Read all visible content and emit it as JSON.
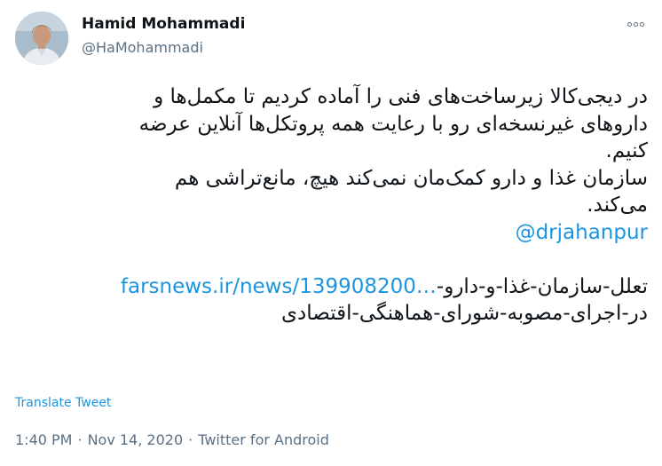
{
  "author": {
    "name": "Hamid Mohammadi",
    "handle": "@HaMohammadi"
  },
  "tweet": {
    "lines": [
      "در دیجی‌کالا زیرساخت‌های فنی را آماده کردیم تا مکمل‌ها و",
      "داروهای غیرنسخه‌ای رو با رعایت همه پروتکل‌ها آنلاین عرضه",
      "کنیم.",
      "سازمان غذا و دارو کمک‌مان نمی‌کند هیچ، مانع‌تراشی هم",
      "می‌کند."
    ],
    "mention": "@drjahanpur",
    "link_text": "farsnews.ir/news/139908200…",
    "link_tail_1": "تعلل-سازمان-غذا-و-دارو-",
    "link_tail_2": "در-اجرای-مصوبه-شورای-هماهنگی-اقتصادی"
  },
  "translate_label": "Translate Tweet",
  "meta": {
    "time": "1:40 PM",
    "date": "Nov 14, 2020",
    "source": "Twitter for Android",
    "separator": "·"
  },
  "icons": {
    "more": "more-options-icon",
    "avatar": "avatar-photo"
  },
  "colors": {
    "link": "#1b95e0",
    "secondary_text": "#5b7083",
    "primary_text": "#0f1419"
  }
}
